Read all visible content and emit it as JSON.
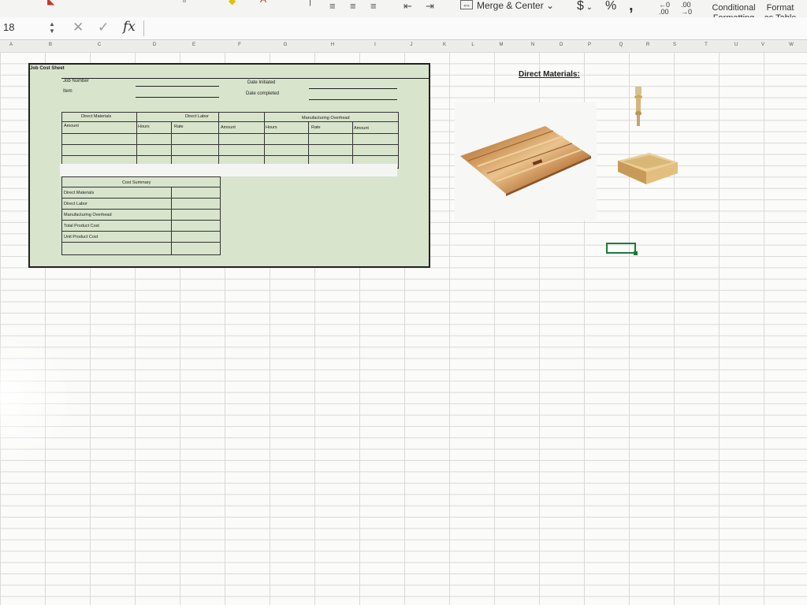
{
  "ribbon": {
    "merge_center_label": "Merge & Center",
    "currency_symbol": "$",
    "percent_symbol": "%",
    "comma_symbol": ",",
    "increase_decimal": "←0 .00",
    "decrease_decimal": ".00 →0",
    "conditional_formatting_label": "Conditional Formatting",
    "format_as_table_label": "Format as Table"
  },
  "formula_bar": {
    "name_box": "18",
    "fx_label": "fx",
    "cancel_glyph": "✕",
    "confirm_glyph": "✓"
  },
  "columns": [
    "A",
    "B",
    "C",
    "D",
    "E",
    "F",
    "G",
    "H",
    "I",
    "J",
    "K",
    "L",
    "M",
    "N",
    "O",
    "P",
    "Q",
    "R",
    "S",
    "T",
    "U",
    "V",
    "W"
  ],
  "job_cost_sheet": {
    "title": "Job Cost Sheet",
    "job_number_label": "Job Number",
    "item_label": "Item",
    "date_initiated_label": "Date Initiated",
    "date_completed_label": "Date completed",
    "groups": {
      "direct_materials": "Direct Materials",
      "direct_labor": "Direct Labor",
      "manufacturing_overhead": "Manufacturing Overhead"
    },
    "headers": [
      "Amount",
      "Hours",
      "Rate",
      "Amount",
      "Hours",
      "Rate",
      "Amount"
    ],
    "cost_summary": {
      "title": "Cost Summary",
      "rows": [
        "Direct Materials",
        "Direct Labor",
        "Manufacturing Overhead",
        "Total Product Cost",
        "Unit Product Cost"
      ]
    }
  },
  "direct_materials_panel": {
    "title": "Direct Materials:",
    "images": [
      "butcher-block-board-image",
      "table-leg-image",
      "wooden-drawer-image"
    ]
  },
  "colors": {
    "sheet_fill": "#d8e4cc",
    "selection": "#1a7a3a",
    "grid_line": "#d9d9d7"
  }
}
